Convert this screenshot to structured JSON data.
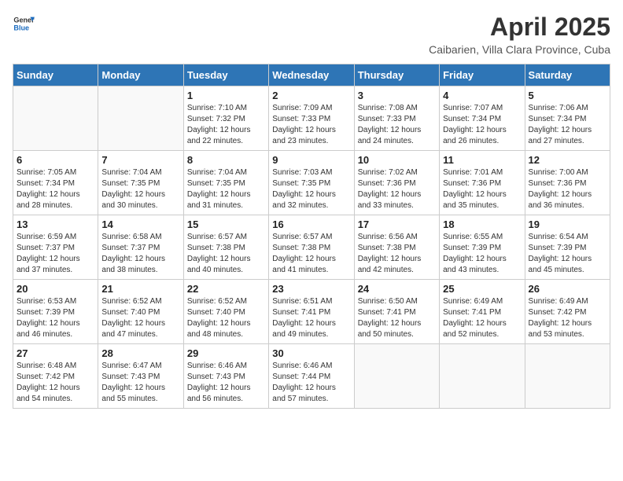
{
  "logo": {
    "text_general": "General",
    "text_blue": "Blue"
  },
  "title": "April 2025",
  "subtitle": "Caibarien, Villa Clara Province, Cuba",
  "days_of_week": [
    "Sunday",
    "Monday",
    "Tuesday",
    "Wednesday",
    "Thursday",
    "Friday",
    "Saturday"
  ],
  "weeks": [
    [
      {
        "day": "",
        "info": ""
      },
      {
        "day": "",
        "info": ""
      },
      {
        "day": "1",
        "info": "Sunrise: 7:10 AM\nSunset: 7:32 PM\nDaylight: 12 hours and 22 minutes."
      },
      {
        "day": "2",
        "info": "Sunrise: 7:09 AM\nSunset: 7:33 PM\nDaylight: 12 hours and 23 minutes."
      },
      {
        "day": "3",
        "info": "Sunrise: 7:08 AM\nSunset: 7:33 PM\nDaylight: 12 hours and 24 minutes."
      },
      {
        "day": "4",
        "info": "Sunrise: 7:07 AM\nSunset: 7:34 PM\nDaylight: 12 hours and 26 minutes."
      },
      {
        "day": "5",
        "info": "Sunrise: 7:06 AM\nSunset: 7:34 PM\nDaylight: 12 hours and 27 minutes."
      }
    ],
    [
      {
        "day": "6",
        "info": "Sunrise: 7:05 AM\nSunset: 7:34 PM\nDaylight: 12 hours and 28 minutes."
      },
      {
        "day": "7",
        "info": "Sunrise: 7:04 AM\nSunset: 7:35 PM\nDaylight: 12 hours and 30 minutes."
      },
      {
        "day": "8",
        "info": "Sunrise: 7:04 AM\nSunset: 7:35 PM\nDaylight: 12 hours and 31 minutes."
      },
      {
        "day": "9",
        "info": "Sunrise: 7:03 AM\nSunset: 7:35 PM\nDaylight: 12 hours and 32 minutes."
      },
      {
        "day": "10",
        "info": "Sunrise: 7:02 AM\nSunset: 7:36 PM\nDaylight: 12 hours and 33 minutes."
      },
      {
        "day": "11",
        "info": "Sunrise: 7:01 AM\nSunset: 7:36 PM\nDaylight: 12 hours and 35 minutes."
      },
      {
        "day": "12",
        "info": "Sunrise: 7:00 AM\nSunset: 7:36 PM\nDaylight: 12 hours and 36 minutes."
      }
    ],
    [
      {
        "day": "13",
        "info": "Sunrise: 6:59 AM\nSunset: 7:37 PM\nDaylight: 12 hours and 37 minutes."
      },
      {
        "day": "14",
        "info": "Sunrise: 6:58 AM\nSunset: 7:37 PM\nDaylight: 12 hours and 38 minutes."
      },
      {
        "day": "15",
        "info": "Sunrise: 6:57 AM\nSunset: 7:38 PM\nDaylight: 12 hours and 40 minutes."
      },
      {
        "day": "16",
        "info": "Sunrise: 6:57 AM\nSunset: 7:38 PM\nDaylight: 12 hours and 41 minutes."
      },
      {
        "day": "17",
        "info": "Sunrise: 6:56 AM\nSunset: 7:38 PM\nDaylight: 12 hours and 42 minutes."
      },
      {
        "day": "18",
        "info": "Sunrise: 6:55 AM\nSunset: 7:39 PM\nDaylight: 12 hours and 43 minutes."
      },
      {
        "day": "19",
        "info": "Sunrise: 6:54 AM\nSunset: 7:39 PM\nDaylight: 12 hours and 45 minutes."
      }
    ],
    [
      {
        "day": "20",
        "info": "Sunrise: 6:53 AM\nSunset: 7:39 PM\nDaylight: 12 hours and 46 minutes."
      },
      {
        "day": "21",
        "info": "Sunrise: 6:52 AM\nSunset: 7:40 PM\nDaylight: 12 hours and 47 minutes."
      },
      {
        "day": "22",
        "info": "Sunrise: 6:52 AM\nSunset: 7:40 PM\nDaylight: 12 hours and 48 minutes."
      },
      {
        "day": "23",
        "info": "Sunrise: 6:51 AM\nSunset: 7:41 PM\nDaylight: 12 hours and 49 minutes."
      },
      {
        "day": "24",
        "info": "Sunrise: 6:50 AM\nSunset: 7:41 PM\nDaylight: 12 hours and 50 minutes."
      },
      {
        "day": "25",
        "info": "Sunrise: 6:49 AM\nSunset: 7:41 PM\nDaylight: 12 hours and 52 minutes."
      },
      {
        "day": "26",
        "info": "Sunrise: 6:49 AM\nSunset: 7:42 PM\nDaylight: 12 hours and 53 minutes."
      }
    ],
    [
      {
        "day": "27",
        "info": "Sunrise: 6:48 AM\nSunset: 7:42 PM\nDaylight: 12 hours and 54 minutes."
      },
      {
        "day": "28",
        "info": "Sunrise: 6:47 AM\nSunset: 7:43 PM\nDaylight: 12 hours and 55 minutes."
      },
      {
        "day": "29",
        "info": "Sunrise: 6:46 AM\nSunset: 7:43 PM\nDaylight: 12 hours and 56 minutes."
      },
      {
        "day": "30",
        "info": "Sunrise: 6:46 AM\nSunset: 7:44 PM\nDaylight: 12 hours and 57 minutes."
      },
      {
        "day": "",
        "info": ""
      },
      {
        "day": "",
        "info": ""
      },
      {
        "day": "",
        "info": ""
      }
    ]
  ]
}
